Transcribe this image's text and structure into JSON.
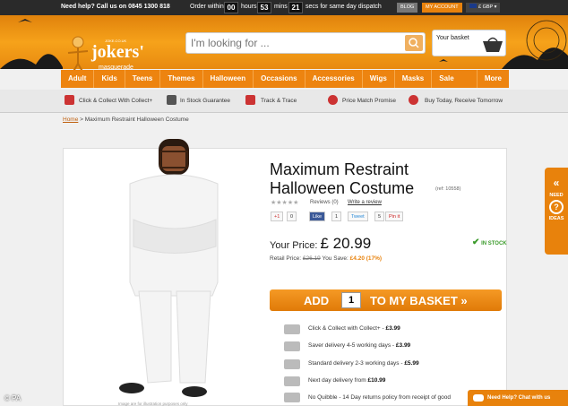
{
  "topbar": {
    "help": "Need help? Call us on 0845 1300 818",
    "order_within": "Order within",
    "hours_val": "00",
    "hours_label": "hours",
    "mins_val": "53",
    "mins_label": "mins",
    "secs_val": "21",
    "secs_label": "secs for same day dispatch",
    "blog": "BLOG",
    "account": "MY ACCOUNT",
    "currency": "£ GBP"
  },
  "logo": {
    "main": "jokers'",
    "sub": "masquerade",
    "small": "JOKE.CO.UK"
  },
  "search": {
    "placeholder": "I'm looking for ..."
  },
  "basket": {
    "label": "Your basket"
  },
  "nav": [
    "Adult",
    "Kids",
    "Teens",
    "Themes",
    "Halloween",
    "Occasions",
    "Accessories",
    "Wigs",
    "Masks",
    "Sale Items",
    "More"
  ],
  "usp": [
    "Click & Collect With Collect+",
    "In Stock Guarantee",
    "Track & Trace",
    "Price Match Promise",
    "Buy Today, Receive Tomorrow"
  ],
  "breadcrumb": {
    "home": "Home",
    "current": "> Maximum Restraint Halloween Costume"
  },
  "product": {
    "title": "Maximum Restraint Halloween Costume",
    "ref": "(ref: 10558)",
    "stars": "★★★★★",
    "reviews": "Reviews (0)",
    "write_review": "Write a review",
    "gplus": "+1",
    "gplus_count": "0",
    "like": "Like",
    "like_count": "1",
    "tweet": "Tweet",
    "tweet_count": "5",
    "pin": "Pin it",
    "price_label": "Your Price:",
    "price": "£ 20.99",
    "in_stock": "IN STOCK",
    "retail_label": "Retail Price:",
    "retail_price": "£26.19",
    "save_label": "You Save:",
    "save_value": "£4.20 (17%)",
    "add_label": "ADD",
    "qty": "1",
    "to_basket": "TO MY BASKET »",
    "image_caption": "Image are for illustration purposes only"
  },
  "delivery": [
    {
      "text": "Click & Collect with Collect+ - ",
      "price": "£3.99"
    },
    {
      "text": "Saver delivery 4-5 working days - ",
      "price": "£3.99"
    },
    {
      "text": "Standard delivery 2-3 working days - ",
      "price": "£5.99"
    },
    {
      "text": "Next day delivery from ",
      "price": "£10.99"
    },
    {
      "text": "No Quibble - 14 Day returns policy from receipt of good",
      "price": ""
    }
  ],
  "side_tab": {
    "arrow": "«",
    "line1": "NEED",
    "line2": "IDEAS"
  },
  "chat": {
    "label": "Need Help? Chat with us"
  },
  "watermark": "© PA",
  "colors": {
    "accent": "#e8820c",
    "nav": "#ed8410",
    "topbar": "#2a2a2a",
    "instock": "#3a9a2a"
  }
}
